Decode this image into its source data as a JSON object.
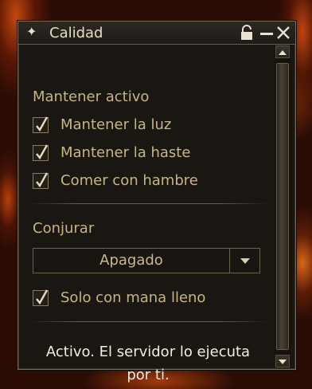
{
  "window": {
    "title": "Calidad",
    "title_icon": "✦",
    "controls": [
      "lock-icon",
      "minimize-icon",
      "close-icon"
    ]
  },
  "keep_active": {
    "heading": "Mantener activo",
    "items": [
      {
        "label": "Mantener la luz",
        "checked": true
      },
      {
        "label": "Mantener la haste",
        "checked": true
      },
      {
        "label": "Comer con hambre",
        "checked": true
      }
    ]
  },
  "conjure": {
    "heading": "Conjurar",
    "dropdown_value": "Apagado",
    "option": {
      "label": "Solo con mana lleno",
      "checked": true
    }
  },
  "status": {
    "text": "Activo. El servidor lo ejecuta por ti."
  },
  "colors": {
    "accent_text": "#c9b47e",
    "border": "#7b6a4e",
    "background": "#1a1612"
  }
}
